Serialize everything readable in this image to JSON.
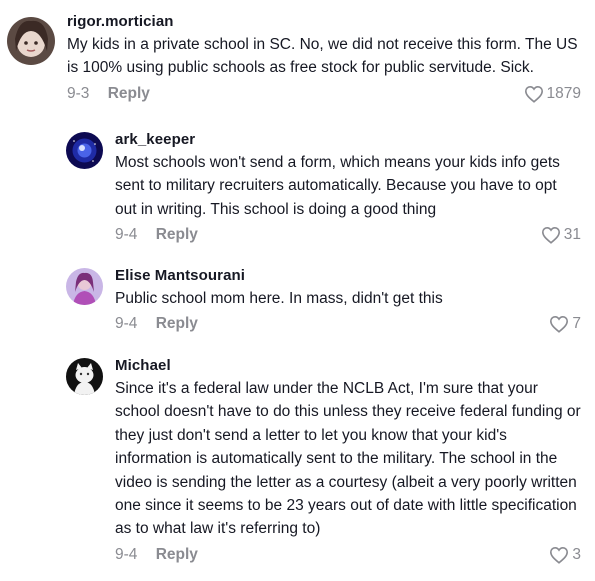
{
  "comments": [
    {
      "username": "rigor.mortician",
      "text": "My kids in a private school in SC. No, we did not receive this form. The US is 100% using public schools as free stock for public servitude. Sick.",
      "date": "9-3",
      "reply": "Reply",
      "likes": "1879"
    },
    {
      "username": "ark_keeper",
      "text": "Most schools won't send a form, which means your kids info gets sent to military recruiters automatically. Because you have to opt out in writing. This school is doing a good thing",
      "date": "9-4",
      "reply": "Reply",
      "likes": "31"
    },
    {
      "username": "Elise Mantsourani",
      "text": "Public school mom here. In mass, didn't get this",
      "date": "9-4",
      "reply": "Reply",
      "likes": "7"
    },
    {
      "username": "Michael",
      "text": "Since it's a federal law under the NCLB Act, I'm sure that your school doesn't have to do this unless they receive federal funding or they just don't send a letter to let you know that your kid's information is automatically sent to the military. The school in the video is sending the letter as a courtesy (albeit a very poorly written one since it seems to be 23 years out of date with little specification as to what law it's referring to)",
      "date": "9-4",
      "reply": "Reply",
      "likes": "3"
    }
  ],
  "colors": {
    "text": "#161823",
    "muted": "#8a8b91"
  },
  "icons": {
    "like": "heart-outline-icon"
  }
}
